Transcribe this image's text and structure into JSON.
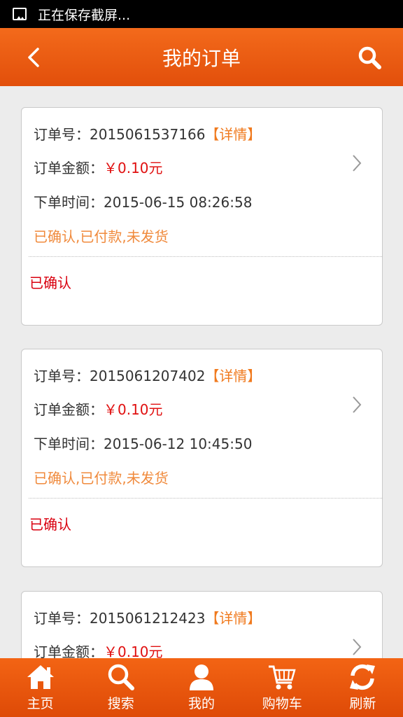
{
  "statusbar": {
    "text": "正在保存截屏..."
  },
  "header": {
    "title": "我的订单"
  },
  "orders": [
    {
      "order_no_label": "订单号：",
      "order_no": "2015061537166",
      "detail_label": "【详情】",
      "amount_label": "订单金额：",
      "amount": "￥0.10元",
      "time_label": "下单时间：",
      "time": "2015-06-15 08:26:58",
      "status": "已确认,已付款,未发货",
      "confirm": "已确认"
    },
    {
      "order_no_label": "订单号：",
      "order_no": "2015061207402",
      "detail_label": "【详情】",
      "amount_label": "订单金额：",
      "amount": "￥0.10元",
      "time_label": "下单时间：",
      "time": "2015-06-12 10:45:50",
      "status": "已确认,已付款,未发货",
      "confirm": "已确认"
    },
    {
      "order_no_label": "订单号：",
      "order_no": "2015061212423",
      "detail_label": "【详情】",
      "amount_label": "订单金额：",
      "amount": "￥0.10元"
    }
  ],
  "tabbar": {
    "items": [
      {
        "label": "主页",
        "icon": "home-icon"
      },
      {
        "label": "搜索",
        "icon": "search-icon"
      },
      {
        "label": "我的",
        "icon": "user-icon"
      },
      {
        "label": "购物车",
        "icon": "cart-icon"
      },
      {
        "label": "刷新",
        "icon": "refresh-icon"
      }
    ]
  },
  "colors": {
    "accent": "#f05a14",
    "price": "#e01010",
    "status": "#f08a3c",
    "confirm": "#d9000f",
    "detail": "#f07a1e"
  }
}
